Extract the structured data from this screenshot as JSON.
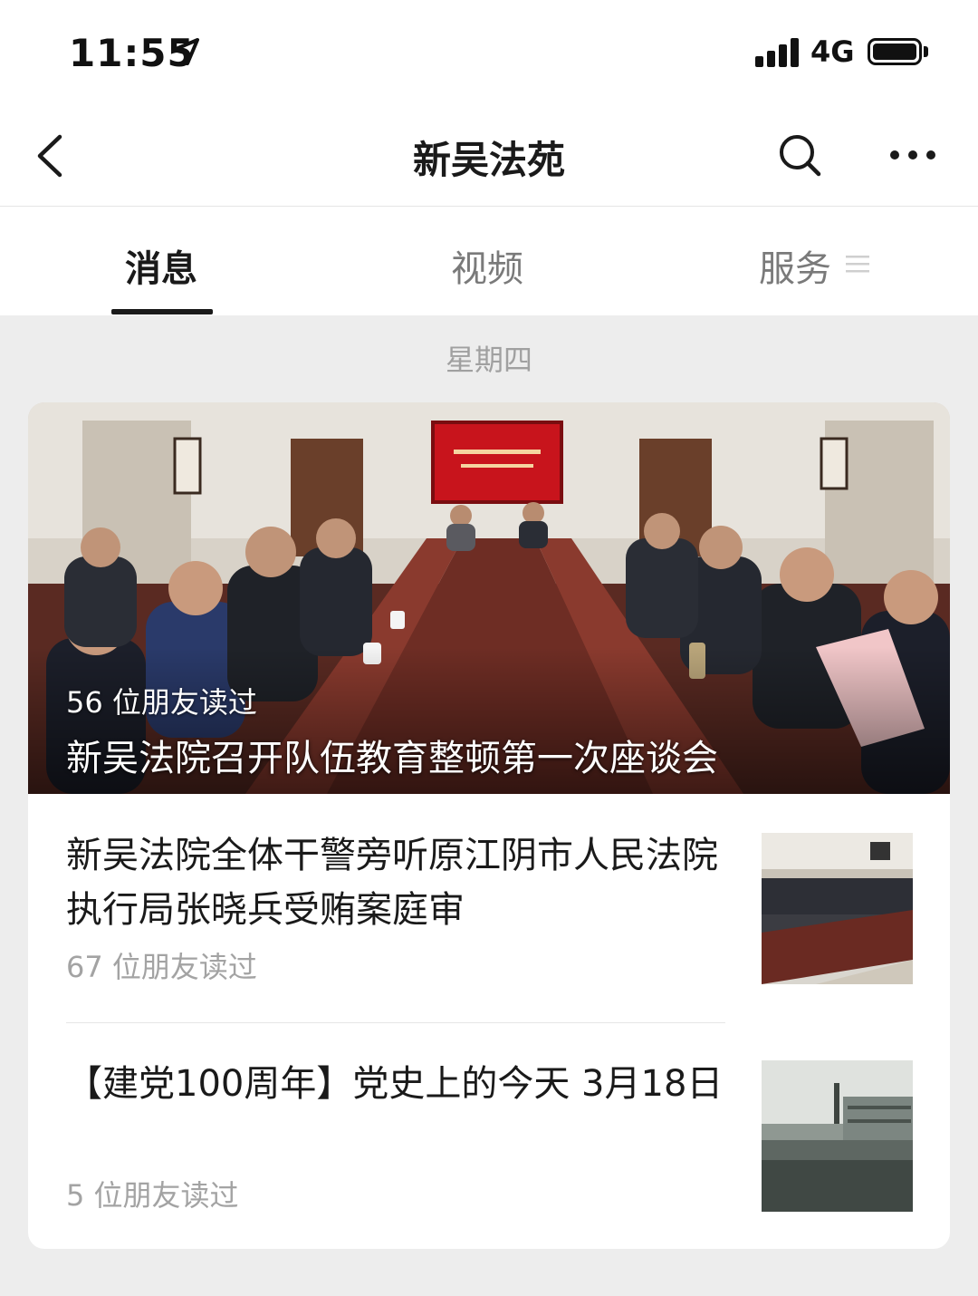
{
  "status_bar": {
    "time": "11:55",
    "network": "4G"
  },
  "nav": {
    "title": "新吴法苑"
  },
  "tabs": [
    {
      "label": "消息",
      "active": true
    },
    {
      "label": "视频",
      "active": false
    },
    {
      "label": "服务",
      "active": false
    }
  ],
  "date_label": "星期四",
  "hero": {
    "reads": "56 位朋友读过",
    "title": "新吴法院召开队伍教育整顿第一次座谈会"
  },
  "articles": [
    {
      "title": "新吴法院全体干警旁听原江阴市人民法院执行局张晓兵受贿案庭审",
      "reads": "67 位朋友读过"
    },
    {
      "title": "【建党100周年】党史上的今天 3月18日",
      "reads": "5 位朋友读过"
    }
  ],
  "colors": {
    "background": "#ededed",
    "card": "#ffffff",
    "text": "#1a1a1a",
    "muted": "#a3a3a3"
  }
}
